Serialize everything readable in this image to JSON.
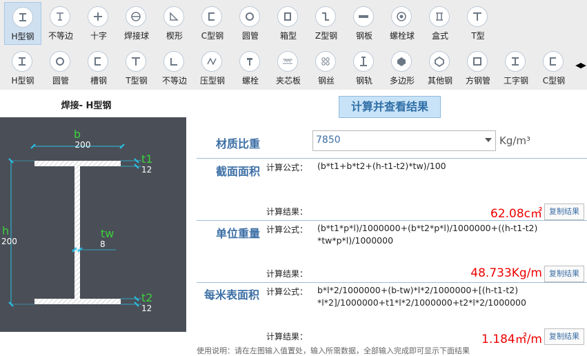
{
  "toolbar": {
    "row1": [
      {
        "label": "H型钢",
        "icon": "h-beam-icon",
        "selected": true
      },
      {
        "label": "不等边",
        "icon": "unequal-angle-t-icon"
      },
      {
        "label": "十字",
        "icon": "cross-icon"
      },
      {
        "label": "焊接球",
        "icon": "welded-ball-icon"
      },
      {
        "label": "楔形",
        "icon": "wedge-icon"
      },
      {
        "label": "C型钢",
        "icon": "c-channel-icon"
      },
      {
        "label": "圆管",
        "icon": "round-tube-icon"
      },
      {
        "label": "箱型",
        "icon": "box-section-icon"
      },
      {
        "label": "Z型钢",
        "icon": "z-section-icon"
      },
      {
        "label": "钢板",
        "icon": "steel-plate-icon"
      },
      {
        "label": "螺栓球",
        "icon": "bolt-ball-icon"
      },
      {
        "label": "盒式",
        "icon": "box-type-icon"
      },
      {
        "label": "T型",
        "icon": "t-section-icon"
      }
    ],
    "row2": [
      {
        "label": "H型钢",
        "icon": "h-beam-icon"
      },
      {
        "label": "圆管",
        "icon": "round-tube-icon"
      },
      {
        "label": "槽钢",
        "icon": "channel-icon"
      },
      {
        "label": "T型钢",
        "icon": "t-section-icon"
      },
      {
        "label": "不等边",
        "icon": "unequal-angle-icon"
      },
      {
        "label": "压型钢",
        "icon": "profiled-steel-icon"
      },
      {
        "label": "螺栓",
        "icon": "bolt-icon"
      },
      {
        "label": "夹芯板",
        "icon": "sandwich-panel-icon"
      },
      {
        "label": "钢丝",
        "icon": "steel-wire-icon"
      },
      {
        "label": "钢轨",
        "icon": "rail-icon"
      },
      {
        "label": "多边形",
        "icon": "polygon-icon"
      },
      {
        "label": "其他钢",
        "icon": "other-steel-icon"
      },
      {
        "label": "方钢管",
        "icon": "square-tube-icon"
      },
      {
        "label": "工字钢",
        "icon": "i-beam-icon"
      },
      {
        "label": "C型钢",
        "icon": "c-channel-icon"
      }
    ],
    "scroll_arrows": "◀▶"
  },
  "left": {
    "title": "焊接- H型钢",
    "diagram": {
      "b_label": "b",
      "b_value": "200",
      "h_label": "h",
      "h_value": "200",
      "t1_label": "t1",
      "t1_value": "12",
      "t2_label": "t2",
      "t2_value": "12",
      "tw_label": "tw",
      "tw_value": "8"
    }
  },
  "main": {
    "calc_button": "计算并查看结果",
    "density": {
      "label": "材质比重",
      "value": "7850",
      "unit": "Kg/m³"
    },
    "sections": [
      {
        "title": "截面面积",
        "formula_label": "计算公式：",
        "formula": [
          "(b*t1+b*t2+(h-t1-t2)*tw)/100"
        ],
        "result_label": "计算结果：",
        "result": "62.08c㎡",
        "copy": "复制结果"
      },
      {
        "title": "单位重量",
        "formula_label": "计算公式：",
        "formula": [
          "(b*t1*p*l)/1000000+(b*t2*p*l)/1000000+((h-t1-t2)",
          "*tw*p*l)/1000000"
        ],
        "result_label": "计算结果：",
        "result": "48.733Kg/m",
        "copy": "复制结果"
      },
      {
        "title": "每米表面积",
        "formula_label": "计算公式：",
        "formula": [
          "b*l*2/1000000+(b-tw)*l*2/1000000+[(h-t1-t2)",
          "*l*2]/1000000+t1*l*2/1000000+t2*l*2/1000000"
        ],
        "result_label": "计算结果：",
        "result": "1.184㎡/m",
        "copy": "复制结果"
      }
    ]
  },
  "footer": {
    "text": "使用说明：请在左图输入值置处，输入所需数据，全部输入完成即可显示下面结果"
  }
}
